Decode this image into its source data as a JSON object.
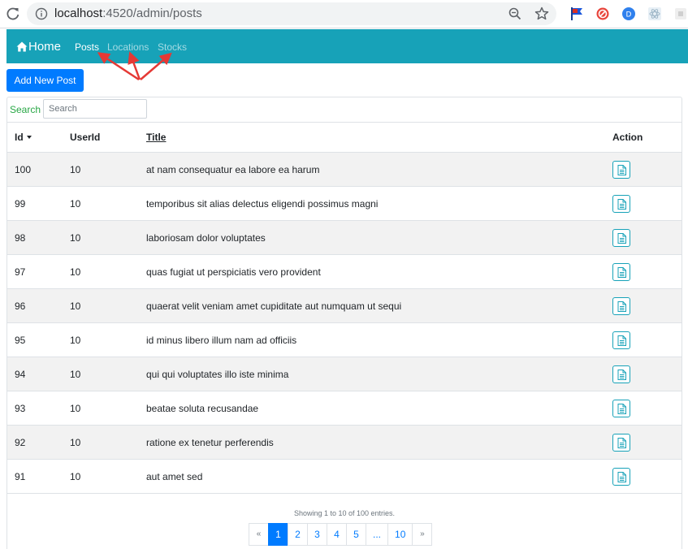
{
  "browser": {
    "url_host": "localhost",
    "url_rest": ":4520/admin/posts"
  },
  "navbar": {
    "brand": "Home",
    "links": [
      "Posts",
      "Locations",
      "Stocks"
    ],
    "color": "#17a2b8"
  },
  "toolbar": {
    "add_label": "Add New Post"
  },
  "search": {
    "label": "Search",
    "placeholder": "Search",
    "value": ""
  },
  "table": {
    "headers": {
      "id": "Id",
      "user_id": "UserId",
      "title": "Title",
      "action": "Action"
    },
    "rows": [
      {
        "id": "100",
        "user_id": "10",
        "title": "at nam consequatur ea labore ea harum"
      },
      {
        "id": "99",
        "user_id": "10",
        "title": "temporibus sit alias delectus eligendi possimus magni"
      },
      {
        "id": "98",
        "user_id": "10",
        "title": "laboriosam dolor voluptates"
      },
      {
        "id": "97",
        "user_id": "10",
        "title": "quas fugiat ut perspiciatis vero provident"
      },
      {
        "id": "96",
        "user_id": "10",
        "title": "quaerat velit veniam amet cupiditate aut numquam ut sequi"
      },
      {
        "id": "95",
        "user_id": "10",
        "title": "id minus libero illum nam ad officiis"
      },
      {
        "id": "94",
        "user_id": "10",
        "title": "qui qui voluptates illo iste minima"
      },
      {
        "id": "93",
        "user_id": "10",
        "title": "beatae soluta recusandae"
      },
      {
        "id": "92",
        "user_id": "10",
        "title": "ratione ex tenetur perferendis"
      },
      {
        "id": "91",
        "user_id": "10",
        "title": "aut amet sed"
      }
    ]
  },
  "footer": {
    "showing": "Showing 1 to 10 of 100 entries.",
    "pages": [
      "«",
      "1",
      "2",
      "3",
      "4",
      "5",
      "...",
      "10",
      "»"
    ]
  },
  "colors": {
    "primary": "#007bff",
    "info": "#17a2b8",
    "success": "#28a745"
  }
}
